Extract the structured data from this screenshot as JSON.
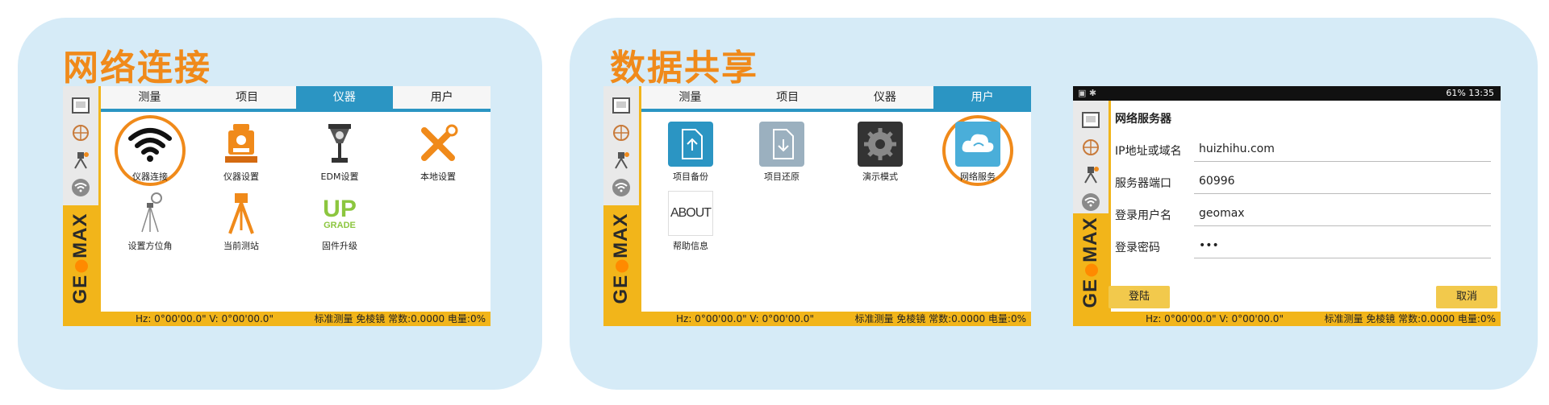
{
  "panels": {
    "left": {
      "title": "网络连接"
    },
    "right": {
      "title": "数据共享"
    }
  },
  "tabs": [
    "测量",
    "项目",
    "仪器",
    "用户"
  ],
  "screen1": {
    "active_tab": "仪器",
    "tiles": [
      {
        "label": "仪器连接",
        "icon": "wifi-icon"
      },
      {
        "label": "仪器设置",
        "icon": "total-station-icon"
      },
      {
        "label": "EDM设置",
        "icon": "prism-icon"
      },
      {
        "label": "本地设置",
        "icon": "tools-icon"
      },
      {
        "label": "设置方位角",
        "icon": "azimuth-icon"
      },
      {
        "label": "当前测站",
        "icon": "tripod-icon"
      },
      {
        "label": "固件升级",
        "icon": "upgrade-icon",
        "icon_text_top": "UP",
        "icon_text_bottom": "GRADE"
      }
    ]
  },
  "screen2": {
    "active_tab": "用户",
    "tiles": [
      {
        "label": "项目备份",
        "icon": "backup-icon"
      },
      {
        "label": "项目还原",
        "icon": "restore-icon"
      },
      {
        "label": "演示模式",
        "icon": "gear-icon"
      },
      {
        "label": "网络服务",
        "icon": "cloud-icon"
      },
      {
        "label": "帮助信息",
        "icon": "about-icon",
        "icon_text": "ABOUT"
      }
    ]
  },
  "screen3": {
    "android_status": {
      "right": "61% 13:35"
    },
    "title": "网络服务器",
    "fields": [
      {
        "label": "IP地址或域名",
        "value": "huizhihu.com"
      },
      {
        "label": "服务器端口",
        "value": "60996"
      },
      {
        "label": "登录用户名",
        "value": "geomax"
      },
      {
        "label": "登录密码",
        "value": "•••"
      }
    ],
    "buttons": {
      "login": "登陆",
      "cancel": "取消"
    }
  },
  "statusbar": {
    "angles": "Hz: 0°00'00.0\"   V: 0°00'00.0\"",
    "info": "标准测量 免棱镜 常数:0.0000 电量:0%"
  },
  "brand": {
    "left": "GE",
    "right": "MAX"
  },
  "colors": {
    "accent_orange": "#f08a1a",
    "tab_blue": "#2b95c3",
    "brand_yellow": "#f2b51a",
    "panel_bg": "#d6ebf7"
  }
}
